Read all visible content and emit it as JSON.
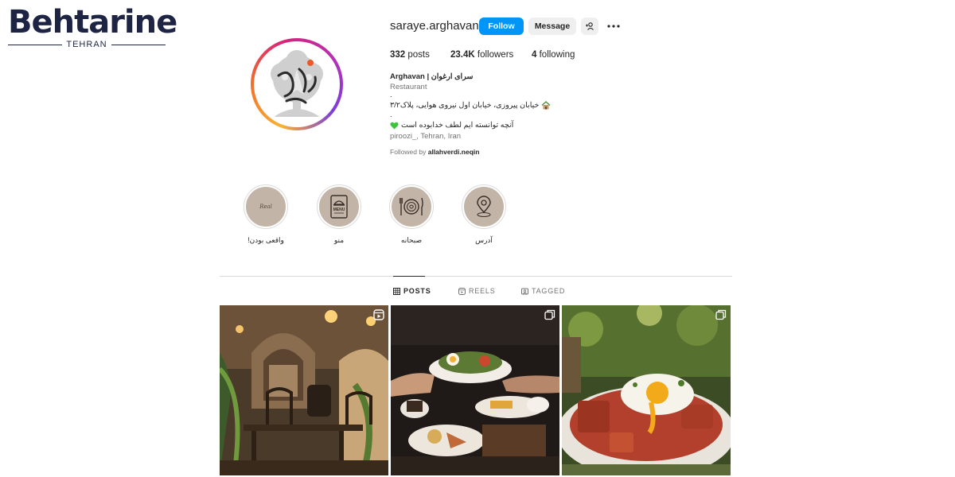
{
  "watermark": {
    "brand": "Behtarine",
    "city": "TEHRAN"
  },
  "profile": {
    "username": "saraye.arghavan",
    "follow_label": "Follow",
    "message_label": "Message",
    "stats": {
      "posts_count": "332",
      "posts_label": "posts",
      "followers_count": "23.4K",
      "followers_label": "followers",
      "following_count": "4",
      "following_label": "following"
    },
    "bio": {
      "name": "Arghavan | سرای ارغوان",
      "category": "Restaurant",
      "dot1": ".",
      "address": "خیابان پیروزی، خیابان اول نیروی هوایی، پلاک۳/۲",
      "dot2": ".",
      "tagline": "آنچه توانسته ایم لطف خدابوده است",
      "location": "piroozi_, Tehran, Iran",
      "followed_by_prefix": "Followed by",
      "followed_by_user": "allahverdi.neqin"
    },
    "avatar_icon": "arghavan-logo-icon"
  },
  "highlights": [
    {
      "label": "واقعی بودن!",
      "icon": "real-text-icon",
      "inner_text": "Real"
    },
    {
      "label": "منو",
      "icon": "menu-book-icon",
      "inner_text": "MENU"
    },
    {
      "label": "صبحانه",
      "icon": "plate-cutlery-icon",
      "inner_text": ""
    },
    {
      "label": "آدرس",
      "icon": "location-pin-icon",
      "inner_text": ""
    }
  ],
  "tabs": [
    {
      "label": "POSTS",
      "icon": "grid-icon",
      "active": true
    },
    {
      "label": "REELS",
      "icon": "reels-icon",
      "active": false
    },
    {
      "label": "TAGGED",
      "icon": "tagged-icon",
      "active": false
    }
  ],
  "posts": [
    {
      "kind": "reel",
      "subject": "cafe-interior-photo"
    },
    {
      "kind": "carousel",
      "subject": "breakfast-plates-photo"
    },
    {
      "kind": "carousel",
      "subject": "fried-egg-dish-photo"
    }
  ],
  "colors": {
    "follow": "#0095f6",
    "accent_highlight": "#c2b4a6",
    "brand": "#1e2544",
    "brand_red": "#d22c3b"
  }
}
